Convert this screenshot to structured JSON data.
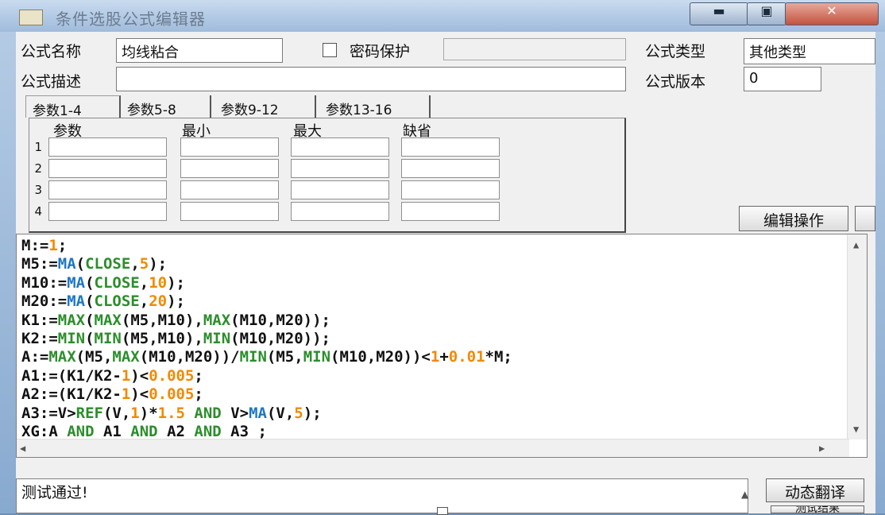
{
  "window": {
    "title": "条件选股公式编辑器",
    "controls": {
      "minimize": "▬",
      "maximize": "▣",
      "close": "✕"
    }
  },
  "form": {
    "name_label": "公式名称",
    "name_value": "均线粘合",
    "password_checked": false,
    "password_label": "密码保护",
    "password_value": "",
    "type_label": "公式类型",
    "type_value": "其他类型",
    "desc_label": "公式描述",
    "desc_value": "",
    "version_label": "公式版本",
    "version_value": "0"
  },
  "tabs": [
    {
      "label": "参数1-4",
      "active": true
    },
    {
      "label": "参数5-8",
      "active": false
    },
    {
      "label": "参数9-12",
      "active": false
    },
    {
      "label": "参数13-16",
      "active": false
    }
  ],
  "param_table": {
    "headers": [
      "参数",
      "最小",
      "最大",
      "缺省"
    ],
    "row_numbers": [
      "1",
      "2",
      "3",
      "4"
    ]
  },
  "buttons": {
    "edit_ops": "编辑操作",
    "dynamic_translate": "动态翻译",
    "test_result": "测试结果"
  },
  "code": [
    [
      [
        "M:=",
        ""
      ],
      [
        "1",
        "num"
      ],
      [
        ";",
        ""
      ]
    ],
    [
      [
        "M5:=",
        ""
      ],
      [
        "MA",
        "fn"
      ],
      [
        "(",
        ""
      ],
      [
        "CLOSE",
        "kw"
      ],
      [
        ",",
        ""
      ],
      [
        "5",
        "num"
      ],
      [
        ");",
        ""
      ]
    ],
    [
      [
        "M10:=",
        ""
      ],
      [
        "MA",
        "fn"
      ],
      [
        "(",
        ""
      ],
      [
        "CLOSE",
        "kw"
      ],
      [
        ",",
        ""
      ],
      [
        "10",
        "num"
      ],
      [
        ");",
        ""
      ]
    ],
    [
      [
        "M20:=",
        ""
      ],
      [
        "MA",
        "fn"
      ],
      [
        "(",
        ""
      ],
      [
        "CLOSE",
        "kw"
      ],
      [
        ",",
        ""
      ],
      [
        "20",
        "num"
      ],
      [
        ");",
        ""
      ]
    ],
    [
      [
        "K1:=",
        ""
      ],
      [
        "MAX",
        "kw"
      ],
      [
        "(",
        ""
      ],
      [
        "MAX",
        "kw"
      ],
      [
        "(M5,M10),",
        ""
      ],
      [
        "MAX",
        "kw"
      ],
      [
        "(M10,M20));",
        ""
      ]
    ],
    [
      [
        "K2:=",
        ""
      ],
      [
        "MIN",
        "kw"
      ],
      [
        "(",
        ""
      ],
      [
        "MIN",
        "kw"
      ],
      [
        "(M5,M10),",
        ""
      ],
      [
        "MIN",
        "kw"
      ],
      [
        "(M10,M20));",
        ""
      ]
    ],
    [
      [
        "A:=",
        ""
      ],
      [
        "MAX",
        "kw"
      ],
      [
        "(M5,",
        ""
      ],
      [
        "MAX",
        "kw"
      ],
      [
        "(M10,M20))/",
        ""
      ],
      [
        "MIN",
        "kw"
      ],
      [
        "(M5,",
        ""
      ],
      [
        "MIN",
        "kw"
      ],
      [
        "(M10,M20))<",
        ""
      ],
      [
        "1",
        "num"
      ],
      [
        "+",
        ""
      ],
      [
        "0.01",
        "num"
      ],
      [
        "*M;",
        ""
      ]
    ],
    [
      [
        "A1:=(K1/K2-",
        ""
      ],
      [
        "1",
        "num"
      ],
      [
        ")<",
        ""
      ],
      [
        "0.005",
        "num"
      ],
      [
        ";",
        ""
      ]
    ],
    [
      [
        "A2:=(K1/K2-",
        ""
      ],
      [
        "1",
        "num"
      ],
      [
        ")<",
        ""
      ],
      [
        "0.005",
        "num"
      ],
      [
        ";",
        ""
      ]
    ],
    [
      [
        "A3:=V>",
        ""
      ],
      [
        "REF",
        "kw"
      ],
      [
        "(V,",
        ""
      ],
      [
        "1",
        "num"
      ],
      [
        ")*",
        ""
      ],
      [
        "1.5",
        "num"
      ],
      [
        " ",
        ""
      ],
      [
        "AND",
        "kw"
      ],
      [
        " V>",
        ""
      ],
      [
        "MA",
        "fn"
      ],
      [
        "(V,",
        ""
      ],
      [
        "5",
        "num"
      ],
      [
        ");",
        ""
      ]
    ],
    [
      [
        "XG:A ",
        ""
      ],
      [
        "AND",
        "kw"
      ],
      [
        " A1 ",
        ""
      ],
      [
        "AND",
        "kw"
      ],
      [
        " A2 ",
        ""
      ],
      [
        "AND",
        "kw"
      ],
      [
        " A3 ;",
        ""
      ]
    ]
  ],
  "status": {
    "message": "测试通过!"
  },
  "colors": {
    "function": "#1c77c5",
    "keyword": "#2c8e2c",
    "number": "#f08a00"
  }
}
